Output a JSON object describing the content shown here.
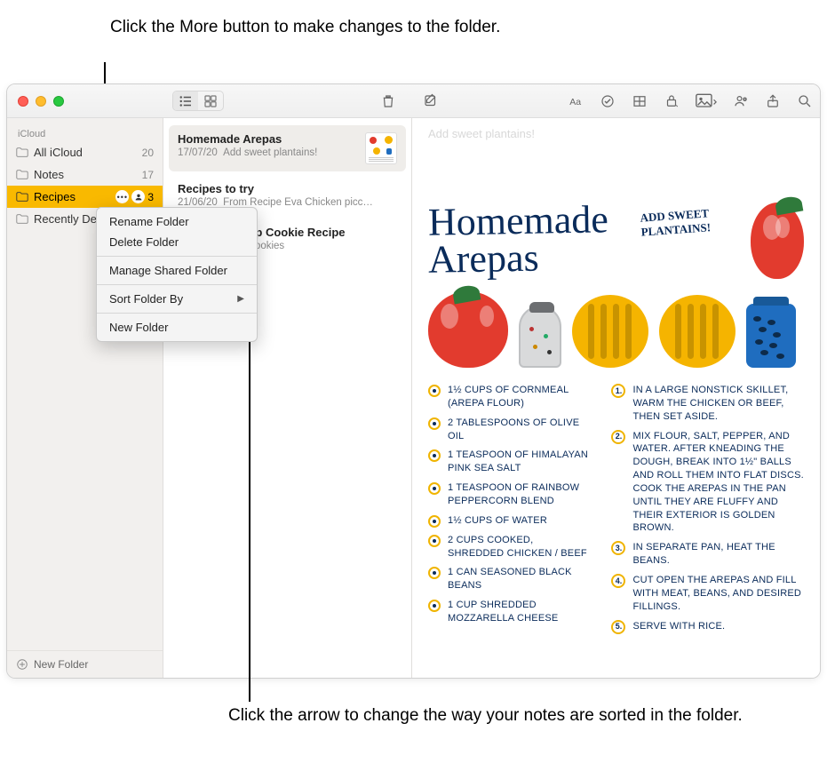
{
  "callouts": {
    "top": "Click the More button to make changes to the folder.",
    "bottom": "Click the arrow to change the way your notes are sorted in the folder."
  },
  "sidebar": {
    "section": "iCloud",
    "items": [
      {
        "label": "All iCloud",
        "count": "20"
      },
      {
        "label": "Notes",
        "count": "17"
      },
      {
        "label": "Recipes",
        "count": "3"
      },
      {
        "label": "Recently Dele…",
        "count": ""
      }
    ],
    "new_folder": "New Folder"
  },
  "context_menu": {
    "rename": "Rename Folder",
    "delete": "Delete Folder",
    "manage_shared": "Manage Shared Folder",
    "sort_by": "Sort Folder By",
    "new_folder": "New Folder"
  },
  "notes": [
    {
      "title": "Homemade Arepas",
      "date": "17/07/20",
      "preview": "Add sweet plantains!"
    },
    {
      "title": "Recipes to try",
      "date": "21/06/20",
      "preview": "From Recipe Eva Chicken picc…"
    },
    {
      "title": "Chocolate Chip Cookie Recipe",
      "date": "",
      "preview": "Makes 4 dozen cookies"
    }
  ],
  "note_body": {
    "faint": "Add sweet plantains!",
    "title_line1": "Homemade",
    "title_line2": "Arepas",
    "annot": "ADD SWEET PLANTAINS!",
    "ingredients": [
      "1½ cups of cornmeal (arepa flour)",
      "2 tablespoons of olive oil",
      "1 teaspoon of Himalayan pink sea salt",
      "1 teaspoon of rainbow peppercorn blend",
      "1½ cups of water",
      "2 cups cooked, shredded chicken / beef",
      "1 can seasoned black beans",
      "1 cup shredded mozzarella cheese"
    ],
    "steps": [
      "In a large nonstick skillet, warm the chicken or beef, then set aside.",
      "Mix flour, salt, pepper, and water. After kneading the dough, break into 1½\" balls and roll them into flat discs. Cook the arepas in the pan until they are fluffy and their exterior is golden brown.",
      "In separate pan, heat the beans.",
      "Cut open the arepas and fill with meat, beans, and desired fillings.",
      "Serve with rice."
    ]
  }
}
